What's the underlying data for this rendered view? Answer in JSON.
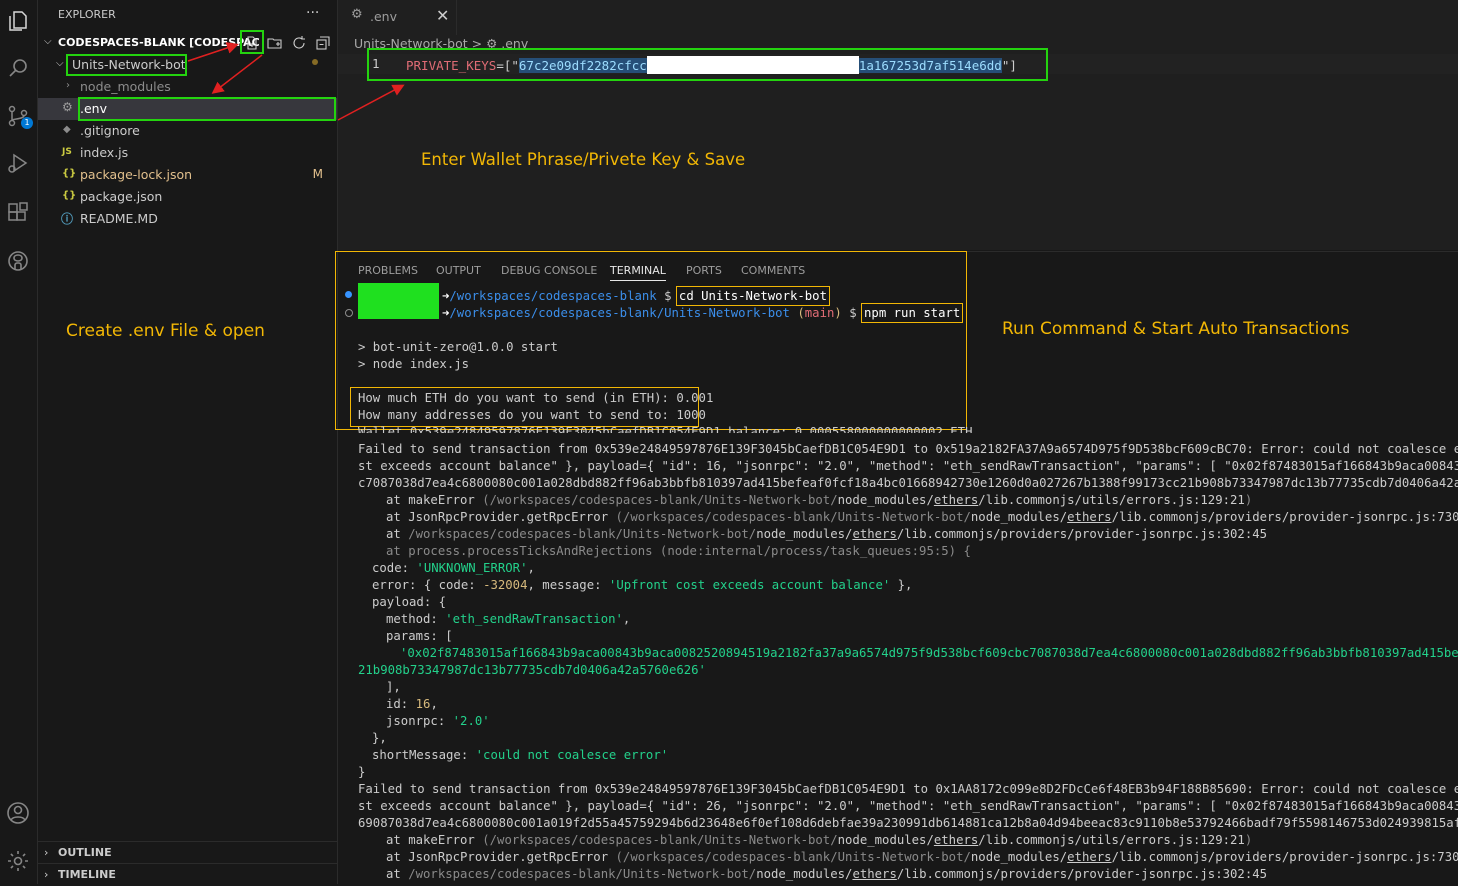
{
  "explorer": {
    "title": "EXPLORER",
    "more": "···",
    "root": "CODESPACES-BLANK [CODESPAC",
    "items": [
      {
        "name": "Units-Network-bot",
        "icon": "chevron-down",
        "color": "#cccccc"
      },
      {
        "name": "node_modules",
        "icon": "chevron-right",
        "color": "#8c8c8c"
      },
      {
        "name": ".env",
        "icon": "gear",
        "color": "#ffffff"
      },
      {
        "name": ".gitignore",
        "icon": "git-diamond",
        "color": "#cccccc"
      },
      {
        "name": "index.js",
        "icon": "JS",
        "color": "#cccccc"
      },
      {
        "name": "package-lock.json",
        "icon": "{}",
        "color": "#e2c08d",
        "badge": "M"
      },
      {
        "name": "package.json",
        "icon": "{}",
        "color": "#cccccc"
      },
      {
        "name": "README.MD",
        "icon": "info",
        "color": "#cccccc"
      }
    ],
    "outline": "OUTLINE",
    "timeline": "TIMELINE",
    "scm_badge": "1"
  },
  "editor": {
    "tab": ".env",
    "breadcrumb": "Units-Network-bot > ⚙ .env",
    "line_number": "1",
    "key": "PRIVATE_KEYS",
    "eq": "=[\"",
    "value_start": "67c2e09df2282cfcc",
    "value_end": "1a167253d7af514e6dd",
    "close": "\"]"
  },
  "annotations": {
    "editor_note": "Enter Wallet Phrase/Privete Key & Save",
    "create_note": "Create .env File & open",
    "run_note": "Run Command & Start Auto Transactions"
  },
  "panel": {
    "tabs": [
      "PROBLEMS",
      "OUTPUT",
      "DEBUG CONSOLE",
      "TERMINAL",
      "PORTS",
      "COMMENTS"
    ],
    "active_tab": "TERMINAL",
    "prompt1_path": "/workspaces/codespaces-blank",
    "prompt1_cmd": "cd Units-Network-bot",
    "prompt2_path": "/workspaces/codespaces-blank/Units-Network-bot",
    "prompt2_branch": "main",
    "prompt2_cmd": "npm run start",
    "lines": {
      "start1": "> bot-unit-zero@1.0.0 start",
      "start2": "> node index.js",
      "q1": "How much ETH do you want to send (in ETH): 0.001",
      "q2": "How many addresses do you want to send to: 1000",
      "wallet": "Wallet 0x539e24849597876E139F3045bCaefDB1C054E9D1 balance: 0.000558000000000002 ETH",
      "f1a": "Failed to send transaction from 0x539e24849597876E139F3045bCaefDB1C054E9D1 to 0x519a2182FA37A9a6574D975f9D538bcF609cBC70: Error: could not coalesce error (er",
      "f1b": "st exceeds account balance\" }, payload={ \"id\": 16, \"jsonrpc\": \"2.0\", \"method\": \"eth_sendRawTransaction\", \"params\": [ \"0x02f87483015af166843b9aca00843b9aca008",
      "f1c": "c7087038d7ea4c6800080c001a028dbd882ff96ab3bbfb810397ad415befeaf0fcf18a4bc01668942730e1260d0a027267b1388f99173cc21b908b73347987dc13b77735cdb7d0406a42a5760e626",
      "st1_pre": "at makeError ",
      "st1_path": "(/workspaces/codespaces-blank/Units-Network-bot/",
      "st1_mod": "node_modules/",
      "st1_eth": "ethers",
      "st1_rest": "/lib.commonjs/utils/errors.js:129:21",
      "st2_pre": "at JsonRpcProvider.getRpcError ",
      "st2_rest": "/lib.commonjs/providers/provider-jsonrpc.js:730:41",
      "st3_pre": "at ",
      "st3_path": "/workspaces/codespaces-blank/Units-Network-bot/",
      "st3_rest": "/lib.commonjs/providers/provider-jsonrpc.js:302:45",
      "st4": "at process.processTicksAndRejections (node:internal/process/task_queues:95:5) {",
      "code_key": "code: ",
      "code_val": "'UNKNOWN_ERROR'",
      "err_key": "error: { code: ",
      "err_num": "-32004",
      "err_msg_key": ", message: ",
      "err_msg": "'Upfront cost exceeds account balance'",
      "err_end": " },",
      "payload": "payload: {",
      "method_key": "method: ",
      "method_val": "'eth_sendRawTransaction'",
      "params": "params: [",
      "hex1": "'0x02f87483015af166843b9aca00843b9aca0082520894519a2182fa37a9a6574d975f9d538bcf609cbc7087038d7ea4c6800080c001a028dbd882ff96ab3bbfb810397ad415befeaf0fcf",
      "hex2": "21b908b73347987dc13b77735cdb7d0406a42a5760e626'",
      "close_arr": "],",
      "id_key": "id: ",
      "id_val": "16",
      "jsonrpc_key": "jsonrpc: ",
      "jsonrpc_val": "'2.0'",
      "close_obj": "},",
      "short_key": "shortMessage: ",
      "short_val": "'could not coalesce error'",
      "close_brace": "}",
      "f2a": "Failed to send transaction from 0x539e24849597876E139F3045bCaefDB1C054E9D1 to 0x1AA8172c099e8D2FDcCe6f48EB3b94F188B85690: Error: could not coalesce error (er",
      "f2b": "st exceeds account balance\" }, payload={ \"id\": 26, \"jsonrpc\": \"2.0\", \"method\": \"eth_sendRawTransaction\", \"params\": [ \"0x02f87483015af166843b9aca00843b9aca008",
      "f2c": "69087038d7ea4c6800080c001a019f2d55a45759294b6d23648e6f0ef108d6debfae39a230991db614881ca12b8a04d94beeac83c9110b8e53792466badf79f5598146753d024939815af07838f1c"
    }
  },
  "colors": {
    "highlight_box": "#24d30f",
    "annotation": "#f2b705",
    "arrow": "#e02020"
  }
}
